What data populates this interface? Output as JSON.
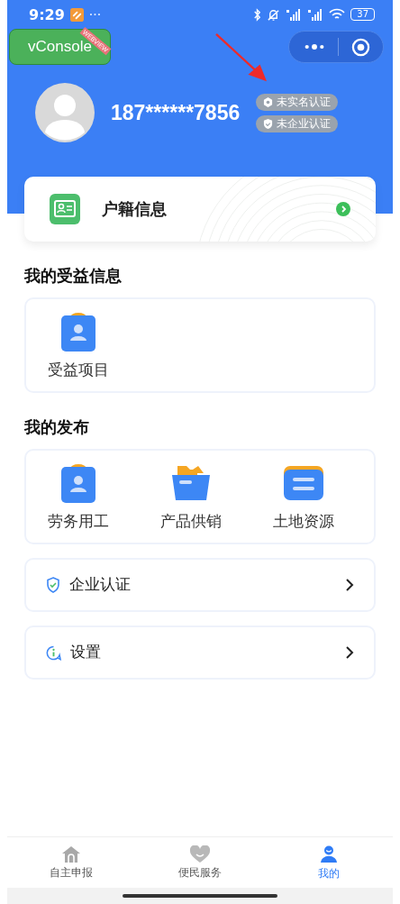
{
  "status_bar": {
    "time": "9:29",
    "dots": "···",
    "battery": "37"
  },
  "vconsole": {
    "label": "vConsole",
    "ribbon": "WEBVIEW"
  },
  "profile": {
    "phone": "187******7856",
    "badges": [
      {
        "label": "未实名认证",
        "kind": "id"
      },
      {
        "label": "未企业认证",
        "kind": "shield"
      }
    ]
  },
  "household": {
    "label": "户籍信息"
  },
  "benefits": {
    "title": "我的受益信息",
    "items": [
      {
        "label": "受益项目",
        "kind": "person"
      }
    ]
  },
  "publish": {
    "title": "我的发布",
    "items": [
      {
        "label": "劳务用工",
        "kind": "person"
      },
      {
        "label": "产品供销",
        "kind": "folder"
      },
      {
        "label": "土地资源",
        "kind": "server"
      }
    ]
  },
  "menu": [
    {
      "label": "企业认证",
      "kind": "shield"
    },
    {
      "label": "设置",
      "kind": "info"
    }
  ],
  "tabbar": [
    {
      "label": "自主申报",
      "kind": "home",
      "selected": false
    },
    {
      "label": "便民服务",
      "kind": "heart",
      "selected": false
    },
    {
      "label": "我的",
      "kind": "user",
      "selected": true
    }
  ]
}
